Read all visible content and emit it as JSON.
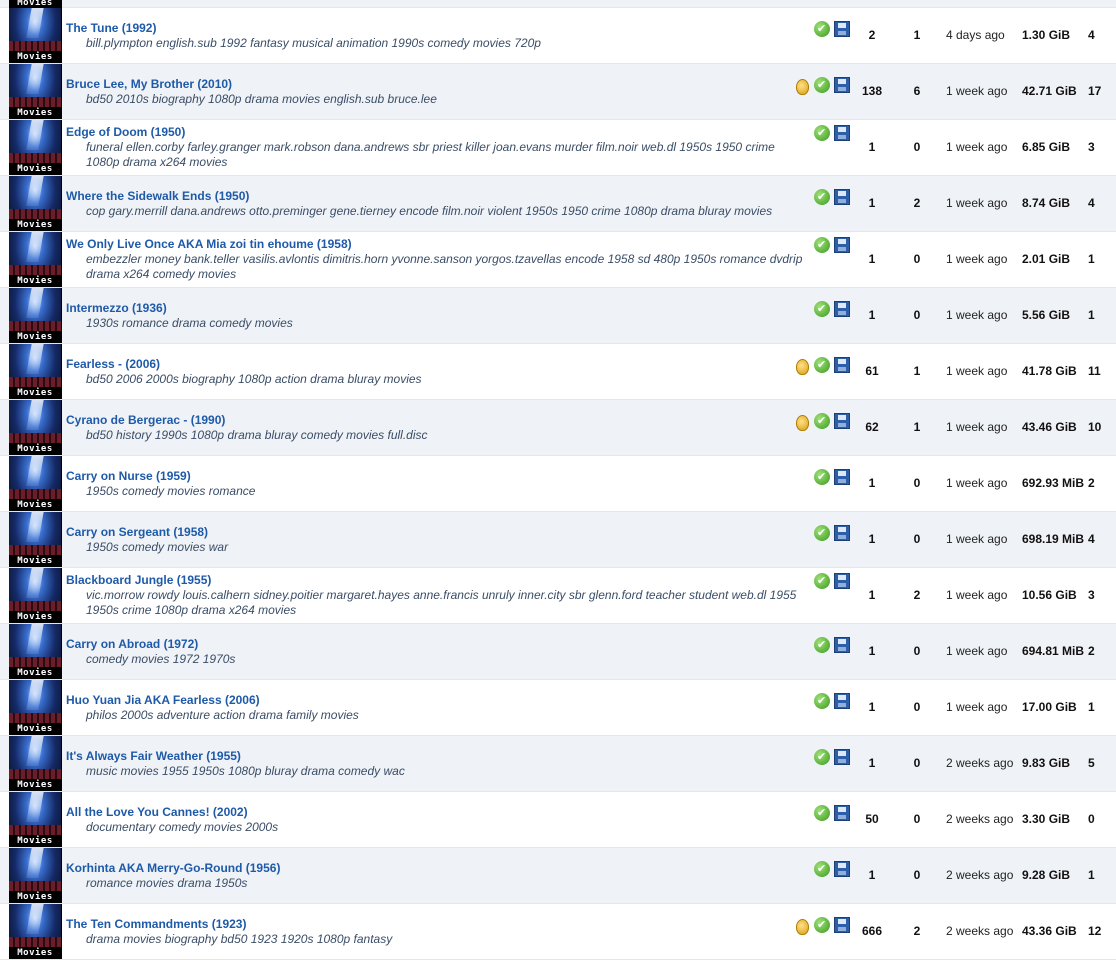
{
  "category_label": "Movies",
  "rows": [
    {
      "title": "The Tune (1992)",
      "tags": "bill.plympton english.sub 1992 fantasy musical animation 1990s comedy movies 720p",
      "award": false,
      "seeders": "2",
      "leechers": "1",
      "added": "4 days ago",
      "size": "1.30 GiB",
      "snatched": "4"
    },
    {
      "title": "Bruce Lee, My Brother (2010)",
      "tags": "bd50 2010s biography 1080p drama movies english.sub bruce.lee",
      "award": true,
      "seeders": "138",
      "leechers": "6",
      "added": "1 week ago",
      "size": "42.71 GiB",
      "snatched": "17"
    },
    {
      "title": "Edge of Doom (1950)",
      "tags": "funeral ellen.corby farley.granger mark.robson dana.andrews sbr priest killer joan.evans murder film.noir web.dl 1950s 1950 crime 1080p drama x264 movies",
      "award": false,
      "seeders": "1",
      "leechers": "0",
      "added": "1 week ago",
      "size": "6.85 GiB",
      "snatched": "3"
    },
    {
      "title": "Where the Sidewalk Ends (1950)",
      "tags": "cop gary.merrill dana.andrews otto.preminger gene.tierney encode film.noir violent 1950s 1950 crime 1080p drama bluray movies",
      "award": false,
      "seeders": "1",
      "leechers": "2",
      "added": "1 week ago",
      "size": "8.74 GiB",
      "snatched": "4"
    },
    {
      "title": "We Only Live Once AKA Mia zoi tin ehoume (1958)",
      "tags": "embezzler money bank.teller vasilis.avlontis dimitris.horn yvonne.sanson yorgos.tzavellas encode 1958 sd 480p 1950s romance dvdrip drama x264 comedy movies",
      "award": false,
      "seeders": "1",
      "leechers": "0",
      "added": "1 week ago",
      "size": "2.01 GiB",
      "snatched": "1"
    },
    {
      "title": "Intermezzo (1936)",
      "tags": "1930s romance drama comedy movies",
      "award": false,
      "seeders": "1",
      "leechers": "0",
      "added": "1 week ago",
      "size": "5.56 GiB",
      "snatched": "1"
    },
    {
      "title": "Fearless - (2006)",
      "tags": "bd50 2006 2000s biography 1080p action drama bluray movies",
      "award": true,
      "seeders": "61",
      "leechers": "1",
      "added": "1 week ago",
      "size": "41.78 GiB",
      "snatched": "11"
    },
    {
      "title": "Cyrano de Bergerac - (1990)",
      "tags": "bd50 history 1990s 1080p drama bluray comedy movies full.disc",
      "award": true,
      "seeders": "62",
      "leechers": "1",
      "added": "1 week ago",
      "size": "43.46 GiB",
      "snatched": "10"
    },
    {
      "title": "Carry on Nurse (1959)",
      "tags": "1950s comedy movies romance",
      "award": false,
      "seeders": "1",
      "leechers": "0",
      "added": "1 week ago",
      "size": "692.93 MiB",
      "snatched": "2"
    },
    {
      "title": "Carry on Sergeant (1958)",
      "tags": "1950s comedy movies war",
      "award": false,
      "seeders": "1",
      "leechers": "0",
      "added": "1 week ago",
      "size": "698.19 MiB",
      "snatched": "4"
    },
    {
      "title": "Blackboard Jungle (1955)",
      "tags": "vic.morrow rowdy louis.calhern sidney.poitier margaret.hayes anne.francis unruly inner.city sbr glenn.ford teacher student web.dl 1955 1950s crime 1080p drama x264 movies",
      "award": false,
      "seeders": "1",
      "leechers": "2",
      "added": "1 week ago",
      "size": "10.56 GiB",
      "snatched": "3"
    },
    {
      "title": "Carry on Abroad (1972)",
      "tags": "comedy movies 1972 1970s",
      "award": false,
      "seeders": "1",
      "leechers": "0",
      "added": "1 week ago",
      "size": "694.81 MiB",
      "snatched": "2"
    },
    {
      "title": "Huo Yuan Jia AKA Fearless (2006)",
      "tags": "philos 2000s adventure action drama family movies",
      "award": false,
      "seeders": "1",
      "leechers": "0",
      "added": "1 week ago",
      "size": "17.00 GiB",
      "snatched": "1"
    },
    {
      "title": "It's Always Fair Weather (1955)",
      "tags": "music movies 1955 1950s 1080p bluray drama comedy wac",
      "award": false,
      "seeders": "1",
      "leechers": "0",
      "added": "2 weeks ago",
      "size": "9.83 GiB",
      "snatched": "5"
    },
    {
      "title": "All the Love You Cannes! (2002)",
      "tags": "documentary comedy movies 2000s",
      "award": false,
      "seeders": "50",
      "leechers": "0",
      "added": "2 weeks ago",
      "size": "3.30 GiB",
      "snatched": "0"
    },
    {
      "title": "Korhinta AKA Merry-Go-Round (1956)",
      "tags": "romance movies drama 1950s",
      "award": false,
      "seeders": "1",
      "leechers": "0",
      "added": "2 weeks ago",
      "size": "9.28 GiB",
      "snatched": "1"
    },
    {
      "title": "The Ten Commandments (1923)",
      "tags": "drama movies biography bd50 1923 1920s 1080p fantasy",
      "award": true,
      "seeders": "666",
      "leechers": "2",
      "added": "2 weeks ago",
      "size": "43.36 GiB",
      "snatched": "12"
    }
  ]
}
